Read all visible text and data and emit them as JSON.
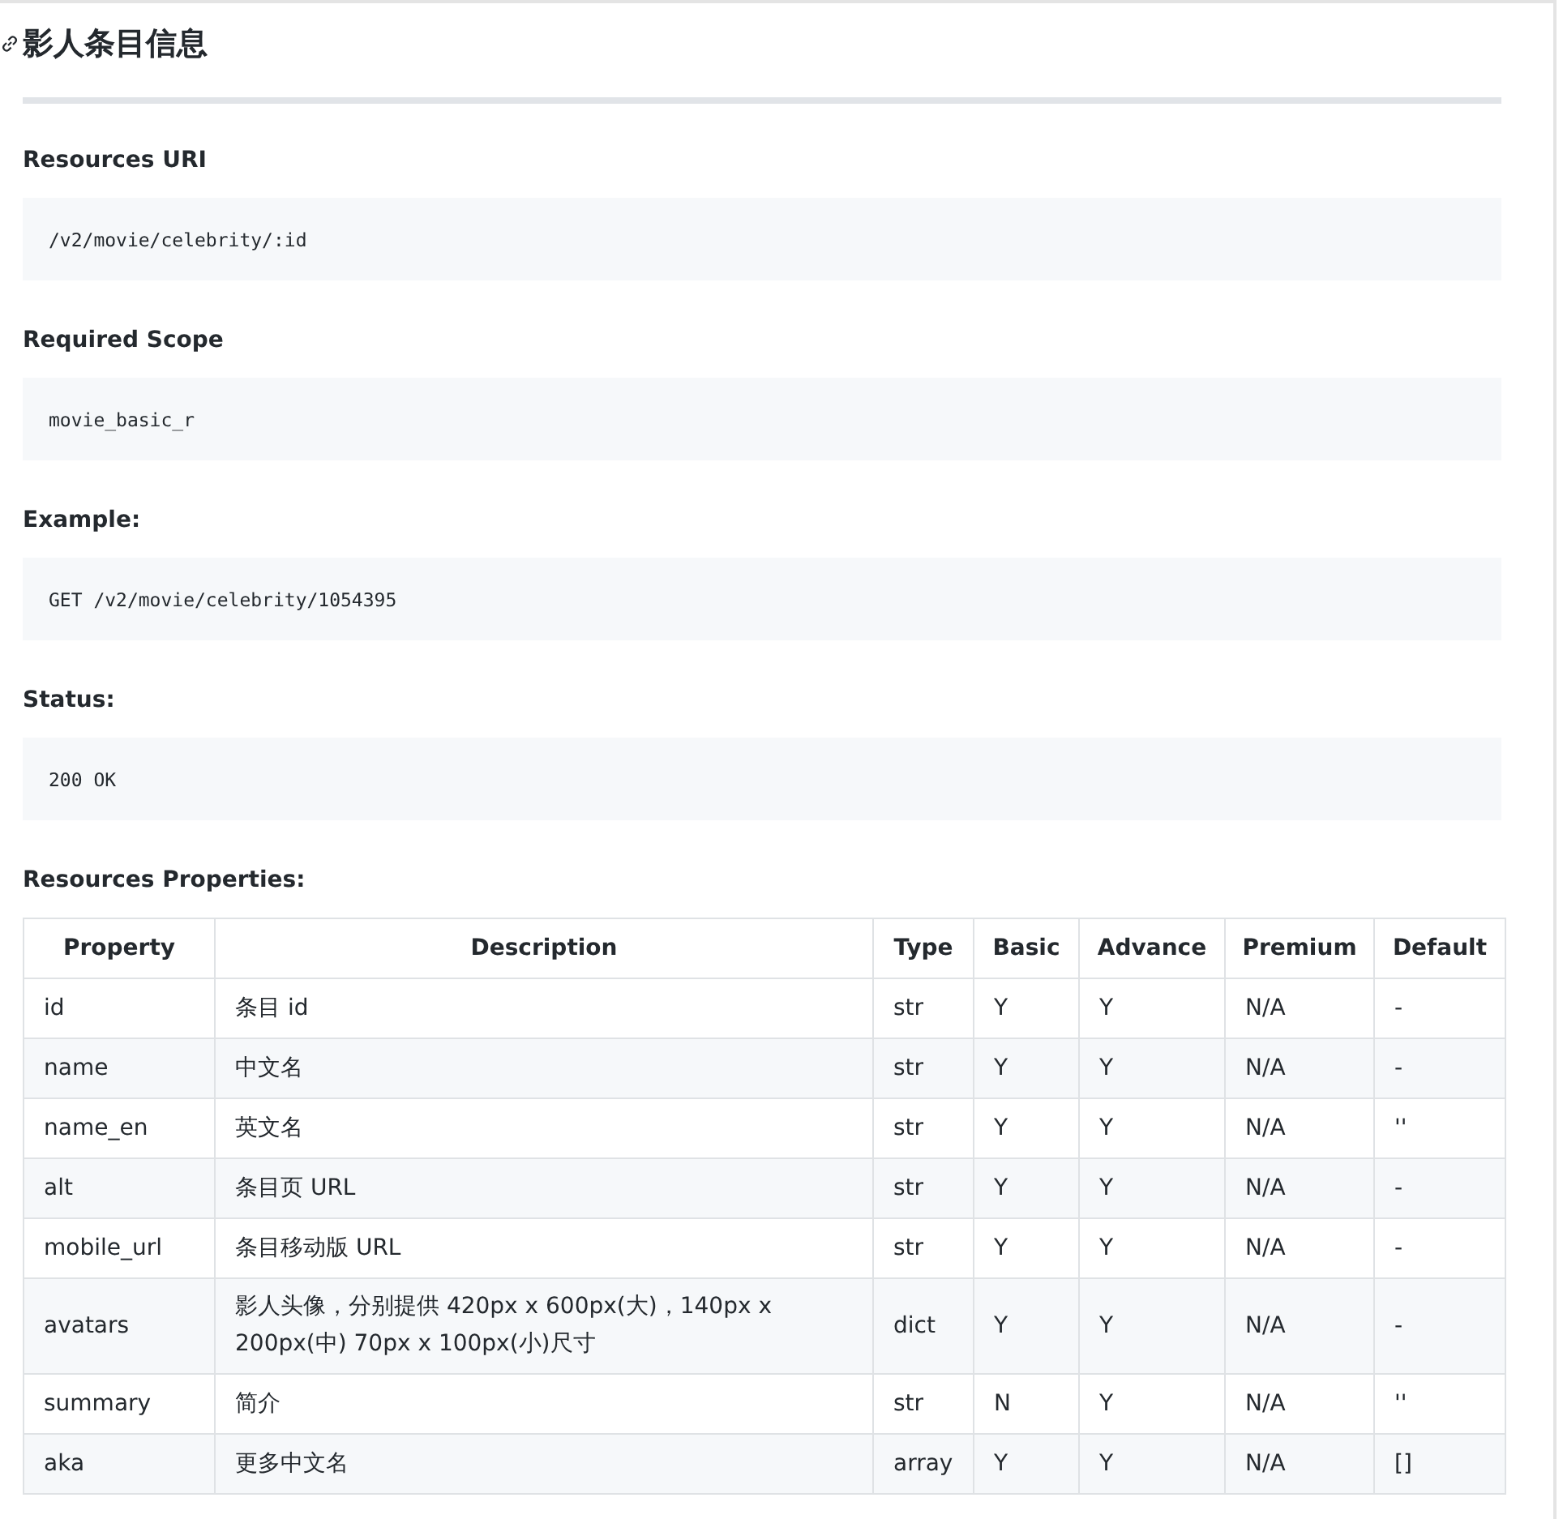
{
  "title": "影人条目信息",
  "sections": [
    {
      "label": "Resources URI",
      "code": "/v2/movie/celebrity/:id"
    },
    {
      "label": "Required Scope",
      "code": "movie_basic_r"
    },
    {
      "label": "Example:",
      "code": "GET /v2/movie/celebrity/1054395"
    },
    {
      "label": "Status:",
      "code": "200 OK"
    }
  ],
  "table_label": "Resources Properties:",
  "table": {
    "columns": [
      "Property",
      "Description",
      "Type",
      "Basic",
      "Advance",
      "Premium",
      "Default"
    ],
    "rows": [
      [
        "id",
        "条目 id",
        "str",
        "Y",
        "Y",
        "N/A",
        "-"
      ],
      [
        "name",
        "中文名",
        "str",
        "Y",
        "Y",
        "N/A",
        "-"
      ],
      [
        "name_en",
        "英文名",
        "str",
        "Y",
        "Y",
        "N/A",
        "''"
      ],
      [
        "alt",
        "条目页 URL",
        "str",
        "Y",
        "Y",
        "N/A",
        "-"
      ],
      [
        "mobile_url",
        "条目移动版 URL",
        "str",
        "Y",
        "Y",
        "N/A",
        "-"
      ],
      [
        "avatars",
        "影人头像，分别提供 420px x 600px(大)，140px x 200px(中) 70px x 100px(小)尺寸",
        "dict",
        "Y",
        "Y",
        "N/A",
        "-"
      ],
      [
        "summary",
        "简介",
        "str",
        "N",
        "Y",
        "N/A",
        "''"
      ],
      [
        "aka",
        "更多中文名",
        "array",
        "Y",
        "Y",
        "N/A",
        "[]"
      ]
    ]
  }
}
